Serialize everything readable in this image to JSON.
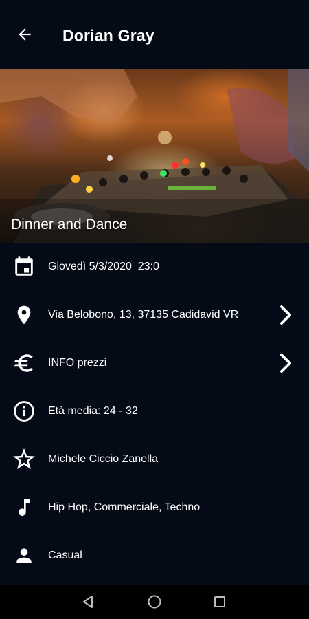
{
  "appbar": {
    "title": "Dorian Gray",
    "back_icon": "arrow-back-icon"
  },
  "hero": {
    "caption": "Dinner and Dance"
  },
  "details": [
    {
      "icon": "calendar-icon",
      "text": "Giovedì 5/3/2020  23:0",
      "has_chevron": false
    },
    {
      "icon": "location-pin-icon",
      "text": "Via Belobono, 13, 37135 Cadidavid VR",
      "has_chevron": true
    },
    {
      "icon": "euro-icon",
      "text": "INFO prezzi",
      "has_chevron": true
    },
    {
      "icon": "info-icon",
      "text": "Età media: 24 - 32",
      "has_chevron": false
    },
    {
      "icon": "star-icon",
      "text": "Michele Ciccio Zanella",
      "has_chevron": false
    },
    {
      "icon": "music-note-icon",
      "text": "Hip Hop, Commerciale, Techno",
      "has_chevron": false
    },
    {
      "icon": "person-icon",
      "text": "Casual",
      "has_chevron": false
    }
  ],
  "navbar": {
    "back": "nav-back-icon",
    "home": "nav-home-icon",
    "recents": "nav-recents-icon"
  },
  "colors": {
    "background": "#040a16",
    "text": "#ffffff",
    "navbar": "#000000"
  }
}
